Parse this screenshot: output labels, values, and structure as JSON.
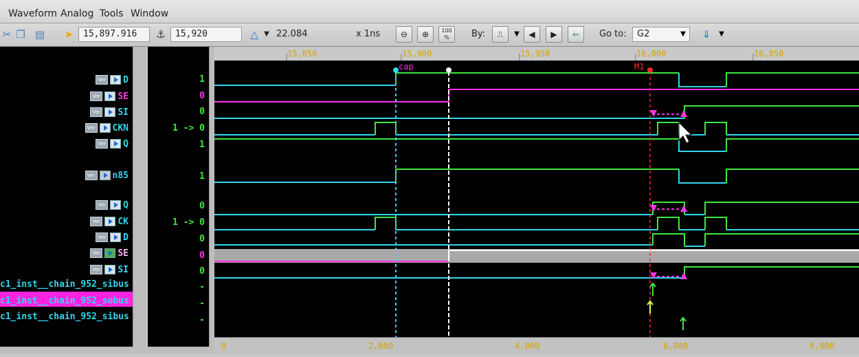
{
  "menu": [
    "Waveform",
    "Analog",
    "Tools",
    "Window"
  ],
  "toolbar": {
    "cursor_time": "15,897.916",
    "marker_time": "15,920",
    "delta": "22.084",
    "scale": "x 1ns",
    "zoom_100": "100 %",
    "by_label": "By:",
    "goto_label": "Go to:",
    "goto_value": "G2"
  },
  "top_ruler": {
    "labels": [
      "15,850",
      "15,900",
      "15,950",
      "16,000",
      "16,050"
    ],
    "markers": {
      "cap": "cap",
      "m1": "M1"
    }
  },
  "bottom_ruler": {
    "labels": [
      "0",
      "2,000",
      "4,000",
      "6,000",
      "8,000"
    ]
  },
  "signals": [
    {
      "badge": "Ver",
      "name": "D",
      "value": "1",
      "color": "#33d6f0"
    },
    {
      "badge": "Ver",
      "name": "SE",
      "value": "0",
      "color": "#ff33e6"
    },
    {
      "badge": "Ver",
      "name": "SI",
      "value": "0",
      "color": "#33d6f0"
    },
    {
      "badge": "Ver",
      "name": "CKN",
      "value": "1 -> 0",
      "color": "#33d6f0"
    },
    {
      "badge": "Ver",
      "name": "Q",
      "value": "1",
      "color": "#33d6f0"
    },
    {
      "badge": "Ver",
      "name": "n85",
      "value": "1",
      "color": "#33d6f0"
    },
    {
      "badge": "Ver",
      "name": "Q",
      "value": "0",
      "color": "#33d6f0"
    },
    {
      "badge": "Ver",
      "name": "CK",
      "value": "1 -> 0",
      "color": "#33d6f0"
    },
    {
      "badge": "Ver",
      "name": "D",
      "value": "0",
      "color": "#33d6f0"
    },
    {
      "badge": "Ver",
      "name": "SE",
      "value": "0",
      "color": "#ff33e6"
    },
    {
      "badge": "Ver",
      "name": "SI",
      "value": "0",
      "color": "#33d6f0"
    }
  ],
  "bus_signals": [
    {
      "name": "c1_inst__chain_952_sibus",
      "value": "-"
    },
    {
      "name": "c1_inst__chain_952_sobus",
      "value": "-"
    },
    {
      "name": "c1_inst__chain_952_sibus",
      "value": "-"
    }
  ],
  "colors": {
    "high": "#3ee83e",
    "low": "#33d6f0",
    "se": "#ff33e6",
    "cursor": "#33d6f0",
    "marker": "#ff2b2b",
    "selected": "#ff22e0"
  }
}
